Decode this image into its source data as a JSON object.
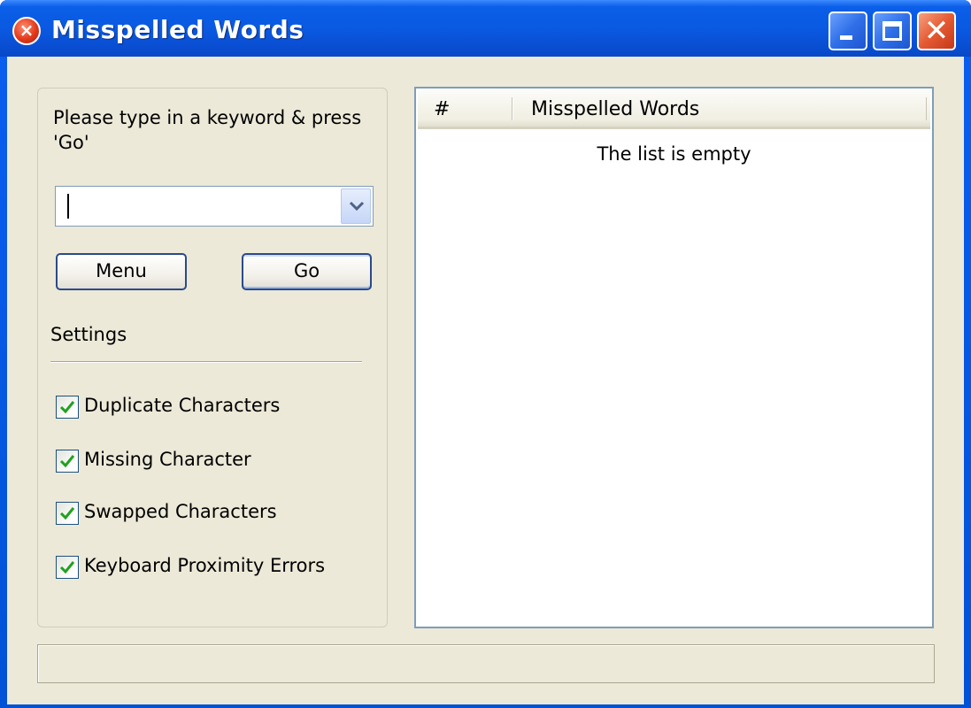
{
  "window": {
    "title": "Misspelled Words"
  },
  "search": {
    "prompt": "Please type in a keyword & press 'Go'",
    "value": ""
  },
  "buttons": {
    "menu": "Menu",
    "go": "Go"
  },
  "settings": {
    "label": "Settings",
    "options": [
      {
        "label": "Duplicate Characters",
        "checked": true
      },
      {
        "label": "Missing Character",
        "checked": true
      },
      {
        "label": "Swapped Characters",
        "checked": true
      },
      {
        "label": "Keyboard Proximity Errors",
        "checked": true
      }
    ]
  },
  "results": {
    "columns": [
      "#",
      "Misspelled Words"
    ],
    "empty_message": "The list is empty"
  },
  "colors": {
    "titlebar": "#0a58e0",
    "client": "#ece9d8",
    "check": "#21a121"
  }
}
